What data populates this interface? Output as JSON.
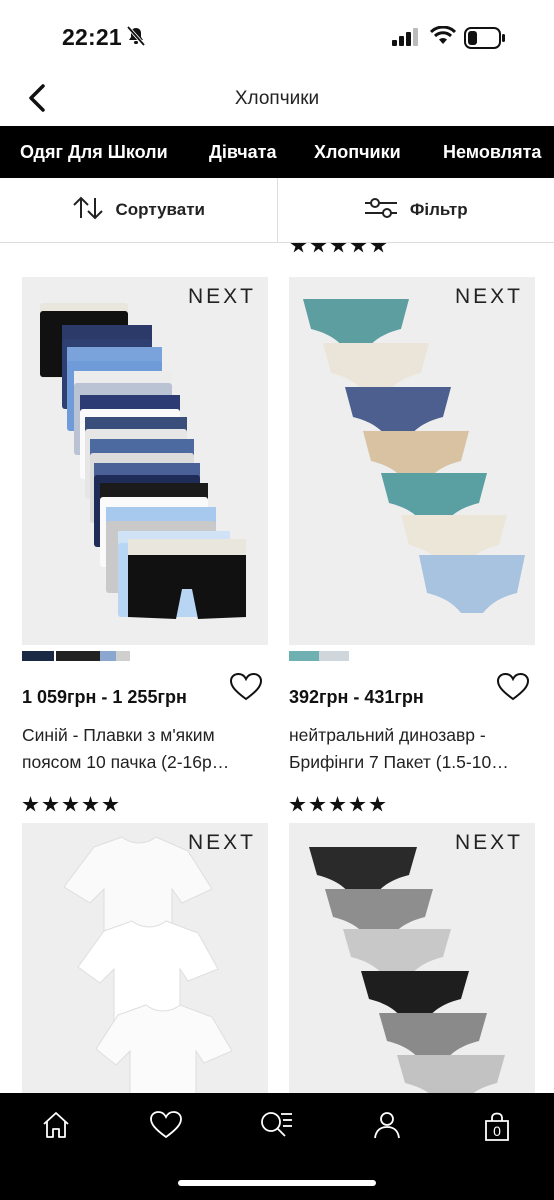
{
  "status_bar": {
    "time": "22:21",
    "icons": [
      "bell-slash-icon",
      "cellular-signal-icon",
      "wifi-icon",
      "battery-icon"
    ]
  },
  "header": {
    "title": "Хлопчики",
    "back_icon": "chevron-left-icon"
  },
  "categories": [
    "Одяг Для Школи",
    "Дівчата",
    "Хлопчики",
    "Немовлята"
  ],
  "toolbar": {
    "sort_label": "Сортувати",
    "sort_icon": "sort-arrows-icon",
    "filter_label": "Фільтр",
    "filter_icon": "sliders-icon"
  },
  "products": [
    {
      "brand": "NEXT",
      "price": "1 059грн - 1 255грн",
      "name": "Синій - Плавки з м'яким поясом 10 пачка (2-16р…",
      "rating": 5,
      "swatch_colors": [
        "#1b2a44",
        "#ffffff",
        "#222222",
        "#8ba7cf",
        "#cfcfcf"
      ]
    },
    {
      "brand": "NEXT",
      "price": "392грн - 431грн",
      "name": "нейтральний динозавр - Брифінги 7 Пакет (1.5-10…",
      "rating": 5,
      "swatch_colors": [
        "#6fb0b3",
        "#cfd6dc",
        "#3c4f7a",
        "#a9c3de"
      ]
    },
    {
      "brand": "NEXT",
      "price": "",
      "name": "",
      "rating": 0
    },
    {
      "brand": "NEXT",
      "price": "",
      "name": "",
      "rating": 0
    }
  ],
  "tabbar": {
    "items": [
      "home-icon",
      "heart-icon",
      "search-list-icon",
      "account-icon",
      "bag-icon"
    ],
    "bag_count": "0"
  },
  "colors": {
    "nav_bg": "#000000",
    "nav_text": "#ffffff",
    "image_bg": "#eeeeee"
  }
}
